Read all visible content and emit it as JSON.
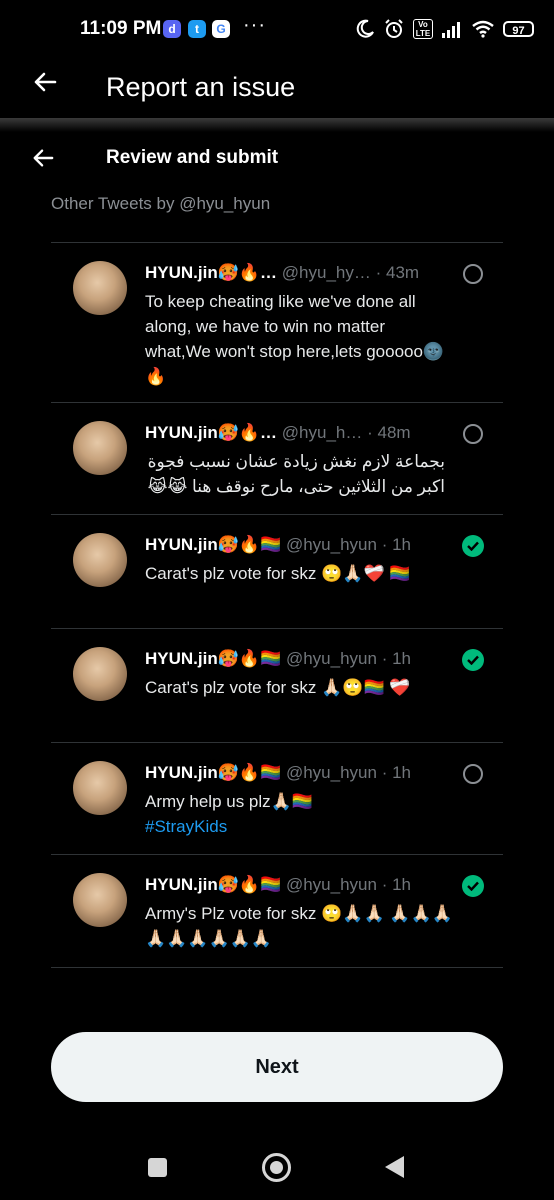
{
  "status_bar": {
    "time": "11:09 PM",
    "apps": [
      {
        "icon": "discord-icon",
        "glyph": "d",
        "color": "#5865f2"
      },
      {
        "icon": "twitter-icon",
        "glyph": "t",
        "color": "#1d9bf0"
      },
      {
        "icon": "google-icon",
        "glyph": "G",
        "color": "#ffffff"
      }
    ],
    "more": "···",
    "network": "Vo LTE",
    "battery": "97"
  },
  "header": {
    "title": "Report an issue",
    "subtitle": "Review and submit"
  },
  "section_label": "Other Tweets by @hyu_hyun",
  "tweets": [
    {
      "name": "HYUN.jin🥵🔥…",
      "handle": "@hyu_hy…",
      "time": "· 43m",
      "text": "To keep cheating like we've done all along, we have to win no matter what,We won't stop here,lets gooooo🌚🔥",
      "hashtag": "",
      "selected": false
    },
    {
      "name": "HYUN.jin🥵🔥…",
      "handle": "@hyu_h…",
      "time": "· 48m",
      "text": "بجماعة لازم نغش زيادة عشان نسبب فجوة اكبر من الثلاثين حتى، مارح نوقف هنا 😹😹",
      "hashtag": "",
      "selected": false,
      "rtl": true
    },
    {
      "name": "HYUN.jin🥵🔥🏳️‍🌈",
      "handle": "@hyu_hyun",
      "time": "· 1h",
      "text": "Carat's plz vote for skz 🙄🙏🏻❤️‍🩹 🏳️‍🌈",
      "hashtag": "",
      "selected": true
    },
    {
      "name": "HYUN.jin🥵🔥🏳️‍🌈",
      "handle": "@hyu_hyun",
      "time": "· 1h",
      "text": "Carat's plz vote for skz 🙏🏻🙄🏳️‍🌈 ❤️‍🩹",
      "hashtag": "",
      "selected": true
    },
    {
      "name": "HYUN.jin🥵🔥🏳️‍🌈",
      "handle": "@hyu_hyun",
      "time": "· 1h",
      "text": "Army help us plz🙏🏻🏳️‍🌈",
      "hashtag": "#StrayKids",
      "selected": false
    },
    {
      "name": "HYUN.jin🥵🔥🏳️‍🌈",
      "handle": "@hyu_hyun",
      "time": "· 1h",
      "text": "Army's Plz vote for skz 🙄🙏🏻🙏🏻 🙏🏻🙏🏻🙏🏻🙏🏻🙏🏻🙏🏻🙏🏻🙏🏻🙏🏻",
      "hashtag": "",
      "selected": true
    }
  ],
  "next_button": "Next",
  "colors": {
    "background": "#000000",
    "checked": "#00ba7c",
    "hashtag": "#1d9bf0",
    "muted": "#71767b"
  }
}
